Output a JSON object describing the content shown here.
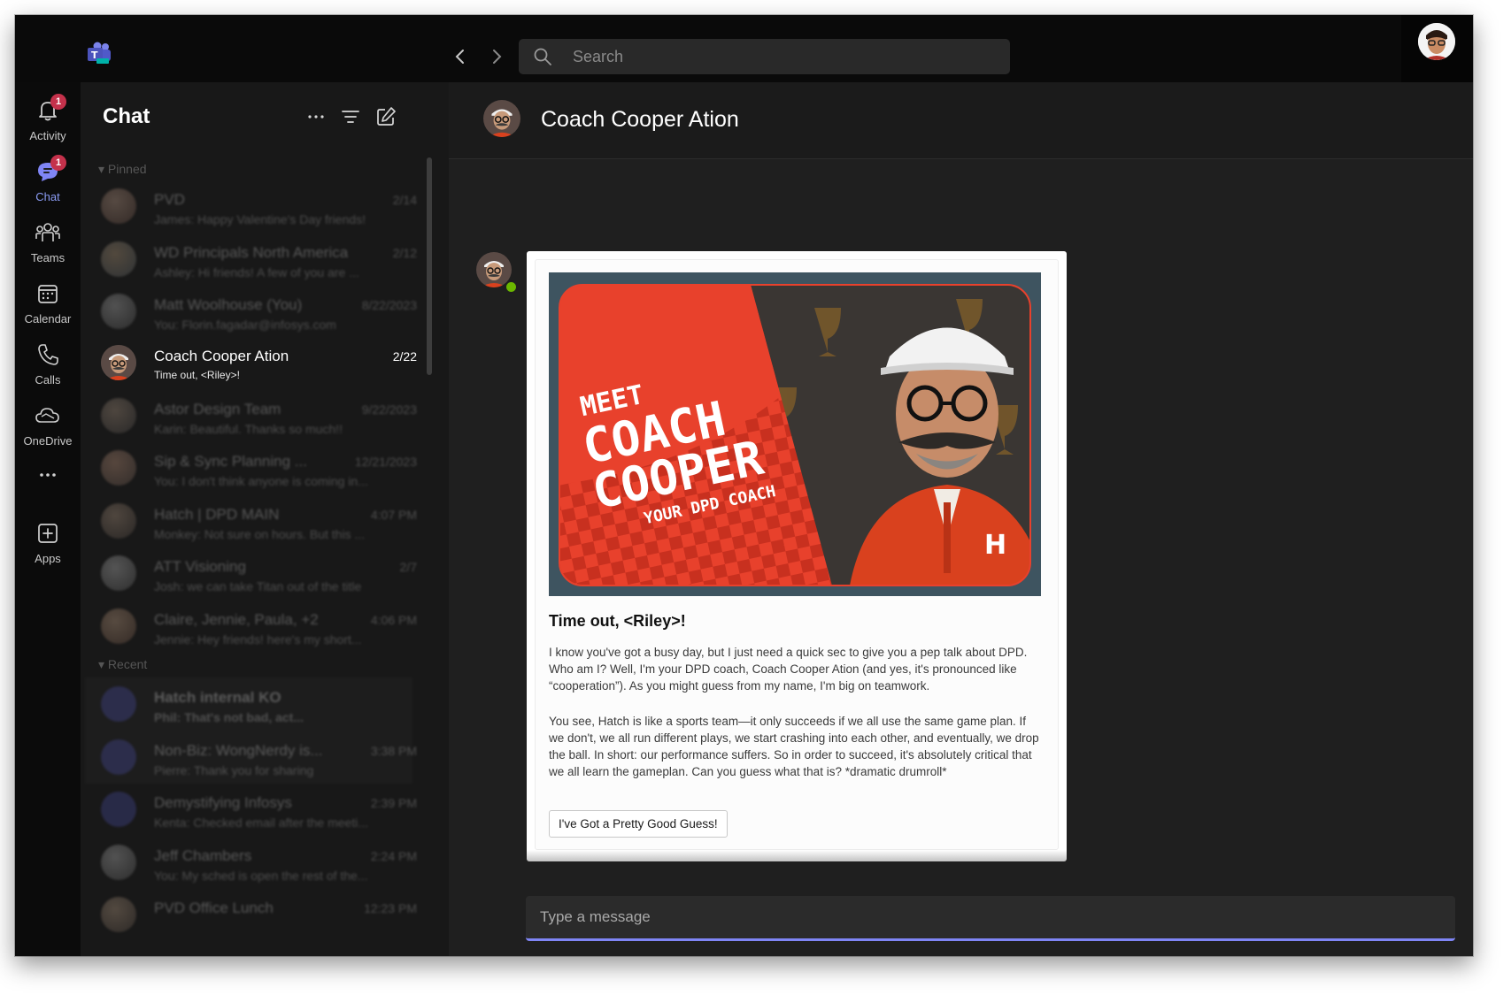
{
  "titlebar": {
    "search_placeholder": "Search"
  },
  "rail": {
    "items": [
      {
        "label": "Activity",
        "icon": "bell-icon",
        "badge": "1"
      },
      {
        "label": "Chat",
        "icon": "chat-icon",
        "badge": "1",
        "active": true
      },
      {
        "label": "Teams",
        "icon": "teams-icon"
      },
      {
        "label": "Calendar",
        "icon": "calendar-icon"
      },
      {
        "label": "Calls",
        "icon": "phone-icon"
      },
      {
        "label": "OneDrive",
        "icon": "cloud-icon"
      },
      {
        "label": "",
        "icon": "more-icon"
      },
      {
        "label": "Apps",
        "icon": "add-apps-icon"
      }
    ]
  },
  "chat_panel": {
    "title": "Chat",
    "pinned_label": "Pinned",
    "recent_label": "Recent",
    "chats": [
      {
        "name": "PVD",
        "time": "2/14",
        "preview": "James: Happy Valentine's Day friends!"
      },
      {
        "name": "WD Principals North America",
        "time": "2/12",
        "preview": "Ashley: Hi friends! A few of you are ..."
      },
      {
        "name": "Matt Woolhouse (You)",
        "time": "8/22/2023",
        "preview": "You: Florin.fagadar@infosys.com"
      },
      {
        "name": "Coach Cooper Ation",
        "time": "2/22",
        "preview": "Time out, <Riley>!",
        "active": true
      },
      {
        "name": "Astor Design Team",
        "time": "9/22/2023",
        "preview": "Karin: Beautiful. Thanks so much!!"
      },
      {
        "name": "Sip & Sync Planning ...",
        "time": "12/21/2023",
        "preview": "You: I don't think anyone is coming in..."
      },
      {
        "name": "Hatch | DPD MAIN",
        "time": "4:07 PM",
        "preview": "Monkey: Not sure on hours. But this ..."
      },
      {
        "name": "ATT Visioning",
        "time": "2/7",
        "preview": "Josh: we can take Titan out of the title"
      },
      {
        "name": "Claire, Jennie, Paula, +2",
        "time": "4:06 PM",
        "preview": "Jennie: Hey friends! here's my short..."
      }
    ],
    "recent": [
      {
        "name": "Hatch internal KO",
        "time": "",
        "preview": "Phil: That's not bad, act..."
      },
      {
        "name": "Non-Biz: WongNerdy is...",
        "time": "3:38 PM",
        "preview": "Pierre: Thank you for sharing"
      },
      {
        "name": "Demystifying Infosys",
        "time": "2:39 PM",
        "preview": "Kenta: Checked email after the meeti..."
      },
      {
        "name": "Jeff Chambers",
        "time": "2:24 PM",
        "preview": "You: My sched is open the rest of the..."
      },
      {
        "name": "PVD Office Lunch",
        "time": "12:23 PM",
        "preview": ""
      }
    ]
  },
  "conversation": {
    "title": "Coach Cooper Ation",
    "card": {
      "hero_text": {
        "meet": "MEET",
        "coach": "COACH",
        "cooper": "COOPER",
        "tagline": "YOUR DPD COACH"
      },
      "heading": "Time out, <Riley>!",
      "paragraph_1": "I know you've got a busy day, but I just need a quick sec to give you a pep talk about DPD. Who am I? Well, I'm your DPD coach, Coach Cooper Ation (and yes, it's pronounced like “cooperation”). As you might guess from my name, I'm big on teamwork.",
      "paragraph_2": "You see, Hatch is like a sports team—it only succeeds if we all use the same game plan. If we don't, we all run different plays, we start crashing into each other, and eventually, we drop the ball. In short: our performance suffers. So in order to succeed, it's absolutely critical that we all learn the gameplan. Can you guess what that is? *dramatic drumroll*",
      "button_label": "I've Got a Pretty Good Guess!"
    },
    "compose_placeholder": "Type a message"
  },
  "colors": {
    "accent": "#7f85f5",
    "badge": "#c4314b",
    "presence": "#6bb700",
    "hero_red": "#e8412c"
  }
}
